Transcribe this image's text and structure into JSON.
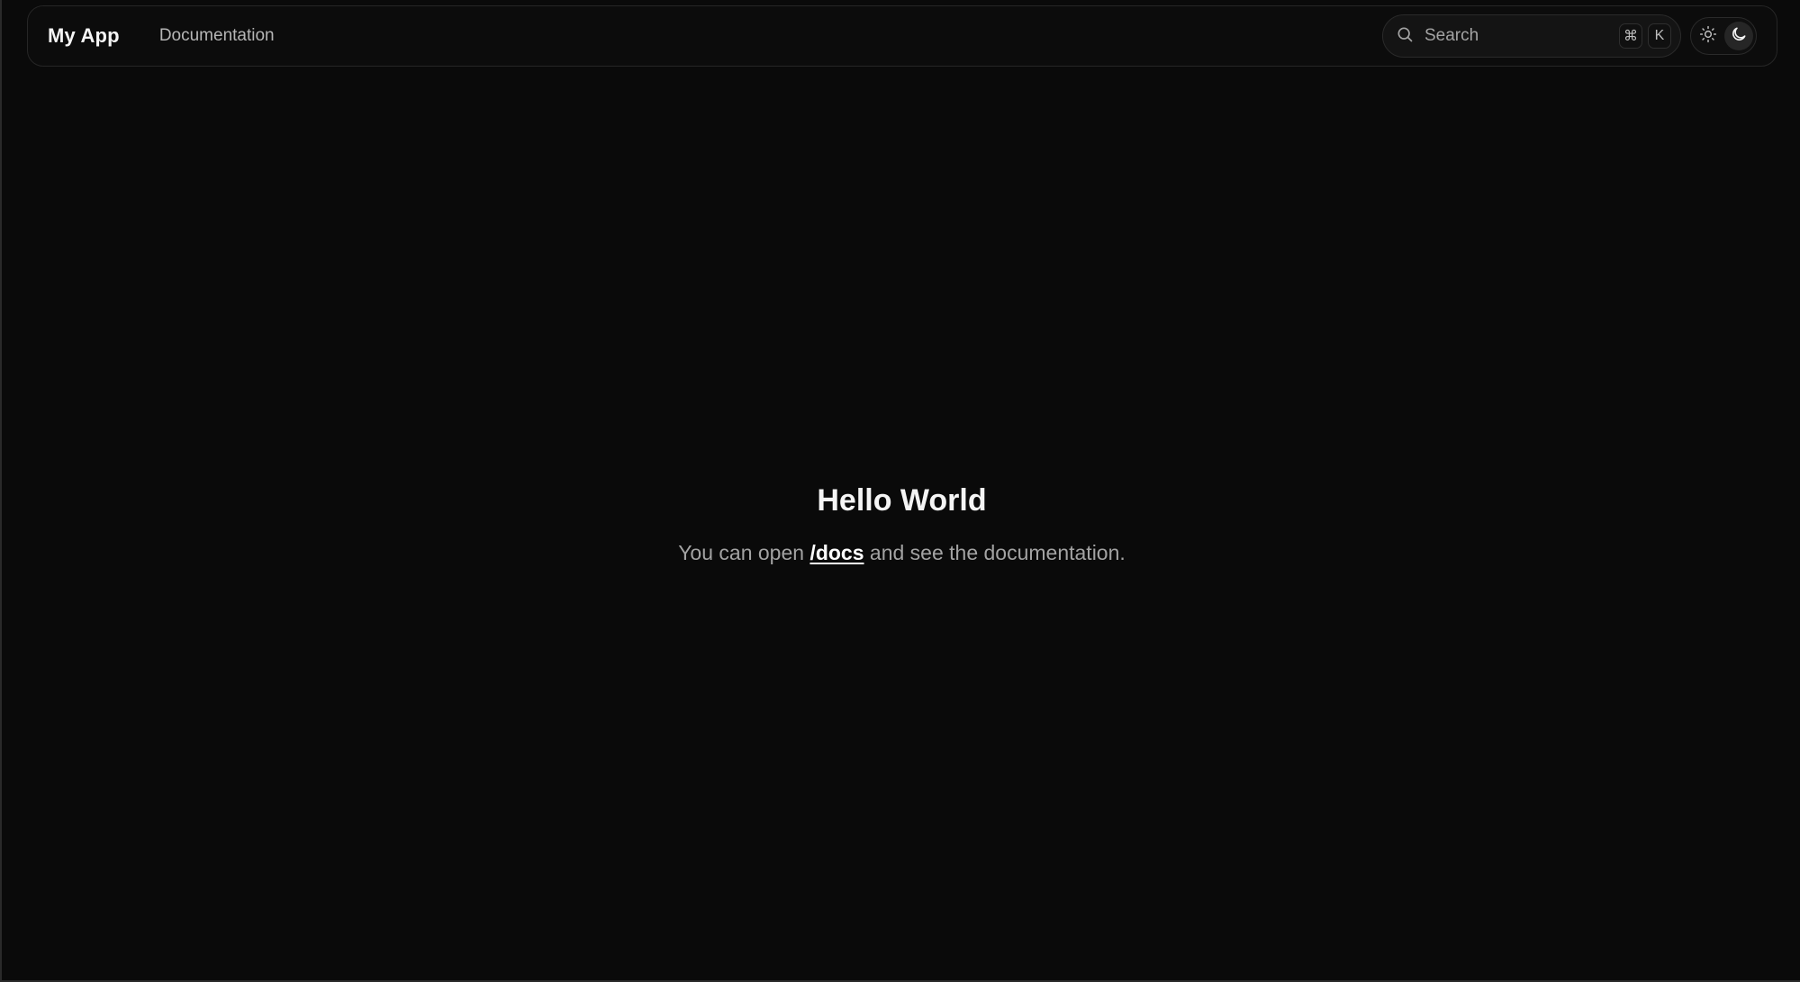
{
  "navbar": {
    "brand": "My App",
    "links": [
      {
        "label": "Documentation"
      }
    ],
    "search": {
      "placeholder": "Search",
      "shortcut_keys": [
        "⌘",
        "K"
      ],
      "icon": "search-icon"
    },
    "theme_toggle": {
      "options": [
        {
          "icon": "sun-icon",
          "label": "light"
        },
        {
          "icon": "moon-icon",
          "label": "dark"
        }
      ],
      "active": "dark"
    }
  },
  "hero": {
    "title": "Hello World",
    "text_before": "You can open ",
    "link_text": "/docs",
    "text_after": " and see the documentation."
  },
  "colors": {
    "background": "#0a0a0a",
    "text_primary": "#f5f5f5",
    "text_muted": "#a3a3a3"
  }
}
